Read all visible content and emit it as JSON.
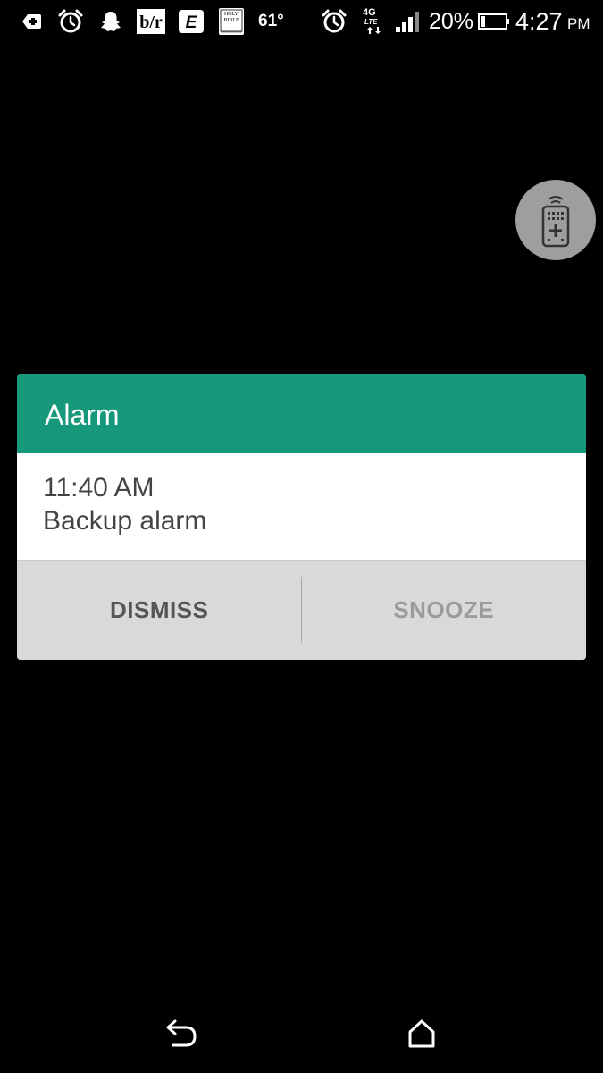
{
  "status_bar": {
    "icons_left": [
      "add-box-icon",
      "alarm-clock-icon",
      "snapchat-ghost-icon",
      "bleacher-report-icon",
      "espn-icon",
      "holy-bible-icon"
    ],
    "bible_label": "HOLY BIBLE",
    "br_label": "b/r",
    "espn_label": "E",
    "temperature": "61°",
    "network_top": "4G",
    "network_bottom": "LTE",
    "battery_percent": "20%",
    "battery_level": 0.2,
    "time": "4:27",
    "ampm": "PM"
  },
  "remote_bubble": {
    "icon": "tv-remote-icon"
  },
  "dialog": {
    "title": "Alarm",
    "header_color": "#16997a",
    "alarm_time": "11:40 AM",
    "alarm_label": "Backup alarm",
    "dismiss_label": "DISMISS",
    "snooze_label": "SNOOZE"
  },
  "nav_bar": {
    "icons": [
      "back-icon",
      "home-icon"
    ]
  }
}
